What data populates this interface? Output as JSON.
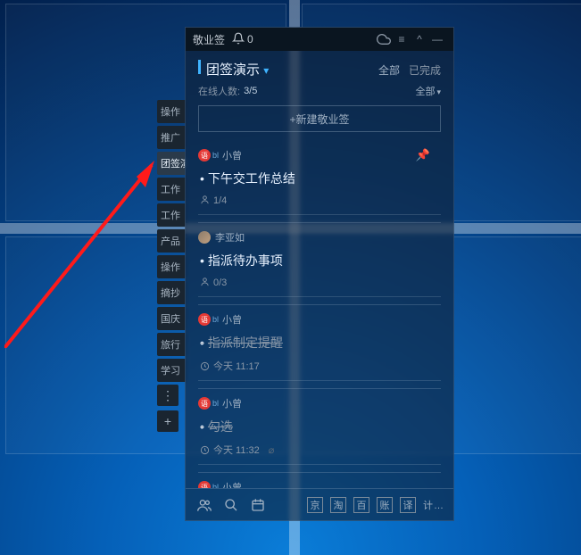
{
  "titlebar": {
    "app_name": "敬业签",
    "bell_count": "0"
  },
  "header": {
    "category_name": "团签演示",
    "filter_all": "全部",
    "filter_done": "已完成"
  },
  "subheader": {
    "online_label": "在线人数:",
    "online_count": "3/5",
    "selector": "全部"
  },
  "new_note_label": "+新建敬业签",
  "side_tabs": [
    "操作",
    "推广",
    "团签演示",
    "工作",
    "工作",
    "产品",
    "操作",
    "摘抄",
    "国庆",
    "旅行",
    "学习"
  ],
  "groups": [
    {
      "assignee": {
        "type": "red",
        "tag": "bl",
        "name": "小曾",
        "pinned": true
      },
      "task": {
        "title": "下午交工作总结",
        "progress": "1/4",
        "done": false,
        "meta_type": "progress"
      }
    },
    {
      "assignee": {
        "type": "img",
        "name": "李亚如"
      },
      "task": {
        "title": "指派待办事项",
        "progress": "0/3",
        "done": false,
        "meta_type": "progress"
      }
    },
    {
      "assignee": {
        "type": "red",
        "tag": "bl",
        "name": "小曾"
      },
      "task": {
        "title": "指派制定提醒",
        "time": "今天 11:17",
        "done": true,
        "meta_type": "time"
      }
    },
    {
      "assignee": {
        "type": "red",
        "tag": "bl",
        "name": "小曾"
      },
      "task": {
        "title": "勾选",
        "time": "今天 11:32",
        "done": true,
        "meta_type": "time_divider"
      }
    },
    {
      "assignee": {
        "type": "red",
        "tag": "bl",
        "name": "小曾"
      }
    }
  ],
  "footer": {
    "shortcuts": [
      "京",
      "淘",
      "百",
      "账",
      "译"
    ],
    "more": "计…"
  }
}
